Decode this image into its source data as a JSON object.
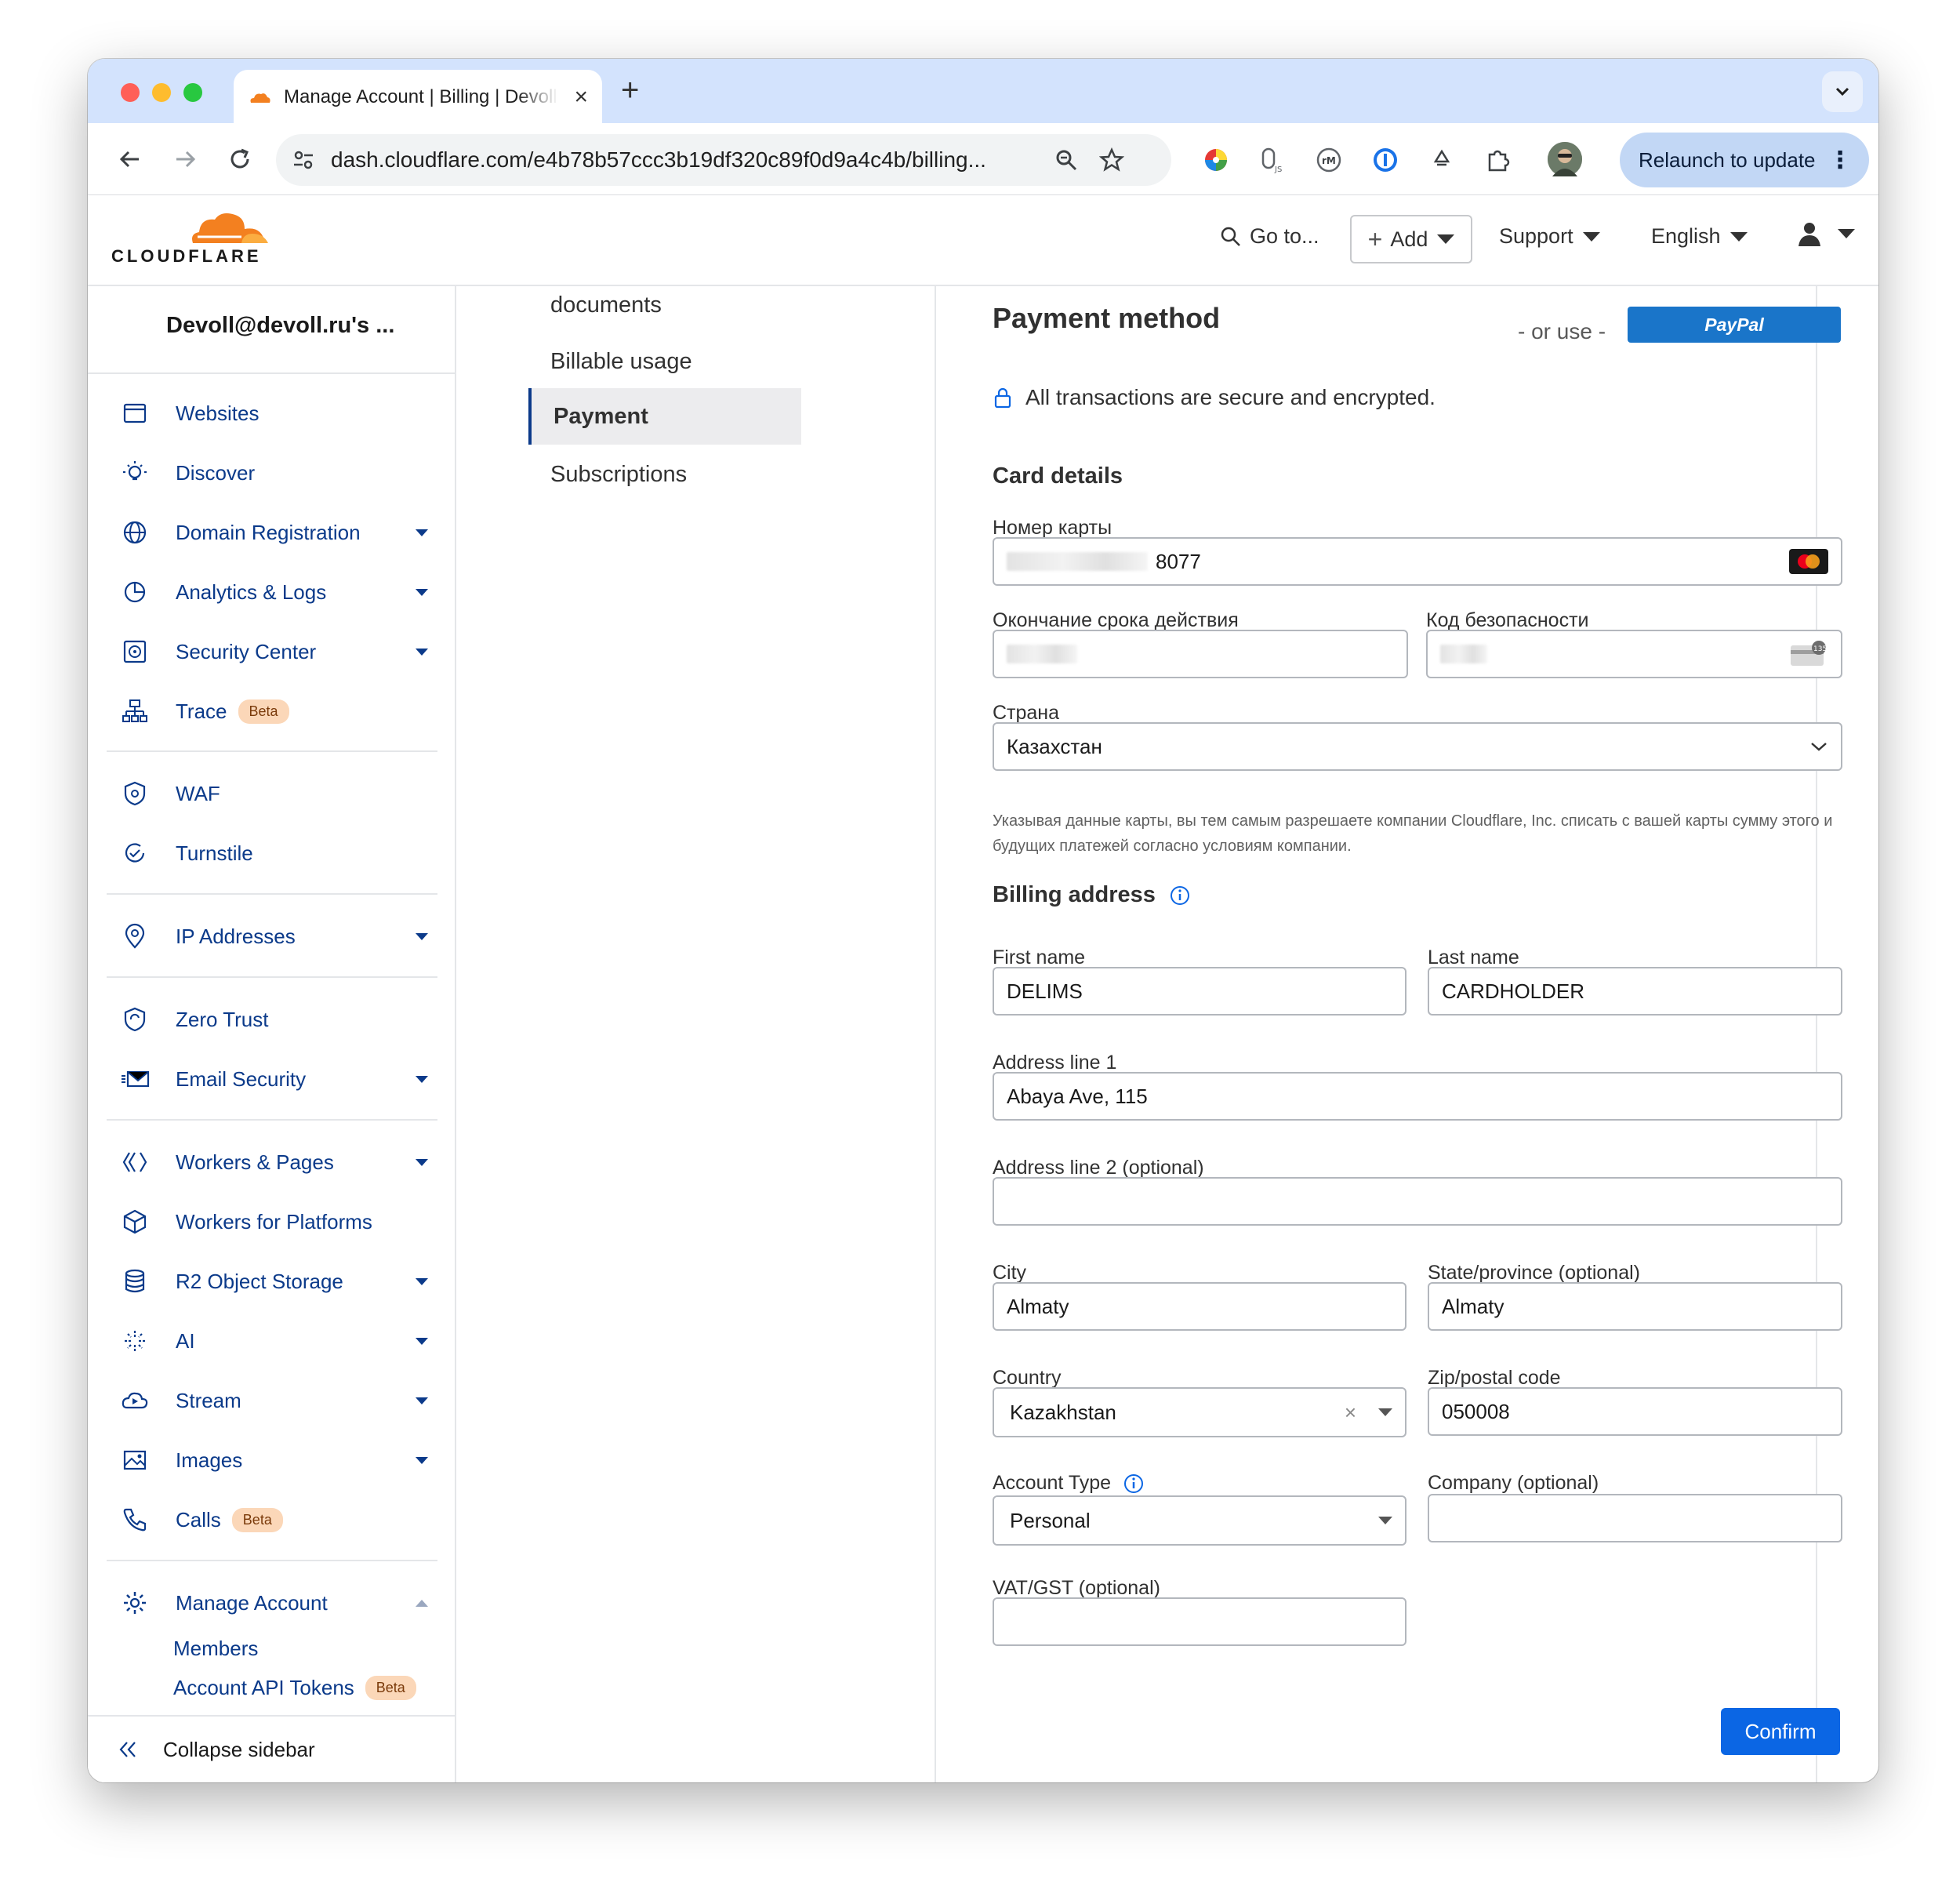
{
  "browser": {
    "tab_title": "Manage Account | Billing | Devoll@devoll.ru's Account | Cloudflare",
    "url": "dash.cloudflare.com/e4b78b57ccc3b19df320c89f0d9a4c4b/billing...",
    "relaunch_label": "Relaunch to update"
  },
  "header": {
    "logo_text": "CLOUDFLARE",
    "goto_label": "Go to...",
    "add_label": "Add",
    "support_label": "Support",
    "language_label": "English"
  },
  "sidebar": {
    "account_name": "Devoll@devoll.ru's ...",
    "items": [
      {
        "label": "Websites",
        "icon": "browser-window-icon"
      },
      {
        "label": "Discover",
        "icon": "lightbulb-icon"
      },
      {
        "label": "Domain Registration",
        "icon": "globe-icon"
      },
      {
        "label": "Analytics & Logs",
        "icon": "pie-chart-icon"
      },
      {
        "label": "Security Center",
        "icon": "radar-icon"
      },
      {
        "label": "Trace",
        "icon": "hierarchy-icon",
        "badge": "Beta"
      },
      {
        "label": "WAF",
        "icon": "shield-gear-icon"
      },
      {
        "label": "Turnstile",
        "icon": "refresh-check-icon"
      },
      {
        "label": "IP Addresses",
        "icon": "map-pin-icon"
      },
      {
        "label": "Zero Trust",
        "icon": "shield-sync-icon"
      },
      {
        "label": "Email Security",
        "icon": "email-icon"
      },
      {
        "label": "Workers & Pages",
        "icon": "workers-icon"
      },
      {
        "label": "Workers for Platforms",
        "icon": "cube-icon"
      },
      {
        "label": "R2 Object Storage",
        "icon": "database-icon"
      },
      {
        "label": "AI",
        "icon": "sparkles-icon"
      },
      {
        "label": "Stream",
        "icon": "cloud-play-icon"
      },
      {
        "label": "Images",
        "icon": "image-icon"
      },
      {
        "label": "Calls",
        "icon": "phone-icon",
        "badge": "Beta"
      },
      {
        "label": "Manage Account",
        "icon": "gear-icon"
      }
    ],
    "sub_items": [
      {
        "label": "Members"
      },
      {
        "label": "Account API Tokens",
        "badge": "Beta"
      }
    ],
    "collapse_label": "Collapse sidebar"
  },
  "subnav": {
    "items": [
      "documents",
      "Billable usage",
      "Payment",
      "Subscriptions"
    ],
    "active": "Payment"
  },
  "main": {
    "title": "Payment method",
    "or_use": "- or use -",
    "paypal_label": "PayPal",
    "secure_text": "All transactions are secure and encrypted.",
    "card_details_title": "Card details",
    "card_number_label": "Номер карты",
    "card_number_value": "8077",
    "expiry_label": "Окончание срока действия",
    "cvc_label": "Код безопасности",
    "country_select_label": "Страна",
    "country_select_value": "Казахстан",
    "fineprint": "Указывая данные карты, вы тем самым разрешаете компании Cloudflare, Inc. списать с вашей карты сумму этого и будущих платежей согласно условиям компании.",
    "billing_title": "Billing address",
    "first_name_label": "First name",
    "first_name_value": "DELIMS",
    "last_name_label": "Last name",
    "last_name_value": "CARDHOLDER",
    "address1_label": "Address line 1",
    "address1_value": "Abaya Ave, 115",
    "address2_label": "Address line 2 (optional)",
    "address2_value": "",
    "city_label": "City",
    "city_value": "Almaty",
    "state_label": "State/province (optional)",
    "state_value": "Almaty",
    "country_label": "Country",
    "country_value": "Kazakhstan",
    "zip_label": "Zip/postal code",
    "zip_value": "050008",
    "account_type_label": "Account Type",
    "account_type_value": "Personal",
    "company_label": "Company (optional)",
    "company_value": "",
    "vat_label": "VAT/GST (optional)",
    "vat_value": "",
    "confirm_label": "Confirm",
    "cvc_icon_text": "135"
  },
  "colors": {
    "cloudflare_orange": "#f38020",
    "link_blue": "#0b3a8a",
    "primary_button": "#0b66e4",
    "paypal_blue": "#1a75c9",
    "beta_badge": "#fbd7b8"
  }
}
